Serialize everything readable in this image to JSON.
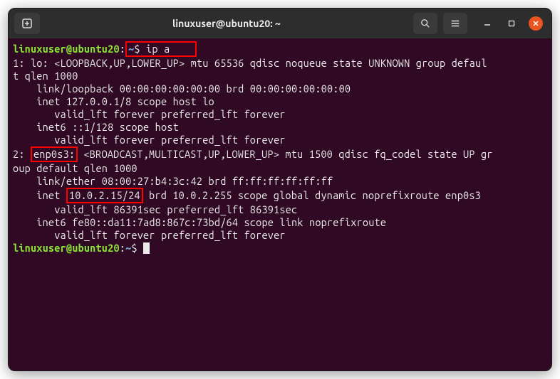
{
  "titlebar": {
    "title": "linuxuser@ubuntu20: ~"
  },
  "prompt": {
    "user_host": "linuxuser@ubuntu20",
    "path": "~",
    "command": "$ ip a"
  },
  "output": {
    "l1": "1: lo: <LOOPBACK,UP,LOWER_UP> mtu 65536 qdisc noqueue state UNKNOWN group defaul",
    "l2": "t qlen 1000",
    "l3": "    link/loopback 00:00:00:00:00:00 brd 00:00:00:00:00:00",
    "l4": "    inet 127.0.0.1/8 scope host lo",
    "l5": "       valid_lft forever preferred_lft forever",
    "l6": "    inet6 ::1/128 scope host ",
    "l7": "       valid_lft forever preferred_lft forever",
    "l8a": "2: ",
    "l8b": "enp0s3:",
    "l8c": " <BROADCAST,MULTICAST,UP,LOWER_UP> mtu 1500 qdisc fq_codel state UP gr",
    "l9": "oup default qlen 1000",
    "l10": "    link/ether 08:00:27:b4:3c:42 brd ff:ff:ff:ff:ff:ff",
    "l11a": "    inet ",
    "l11b": "10.0.2.15/24",
    "l11c": " brd 10.0.2.255 scope global dynamic noprefixroute enp0s3",
    "l12": "       valid_lft 86391sec preferred_lft 86391sec",
    "l13": "    inet6 fe80::da11:7ad8:867c:73bd/64 scope link noprefixroute ",
    "l14": "       valid_lft forever preferred_lft forever"
  },
  "prompt2": {
    "user_host": "linuxuser@ubuntu20",
    "path": "~",
    "dollar": "$ "
  },
  "highlights": {
    "command": "$ ip a",
    "interface": "enp0s3:",
    "ip": "10.0.2.15/24"
  }
}
